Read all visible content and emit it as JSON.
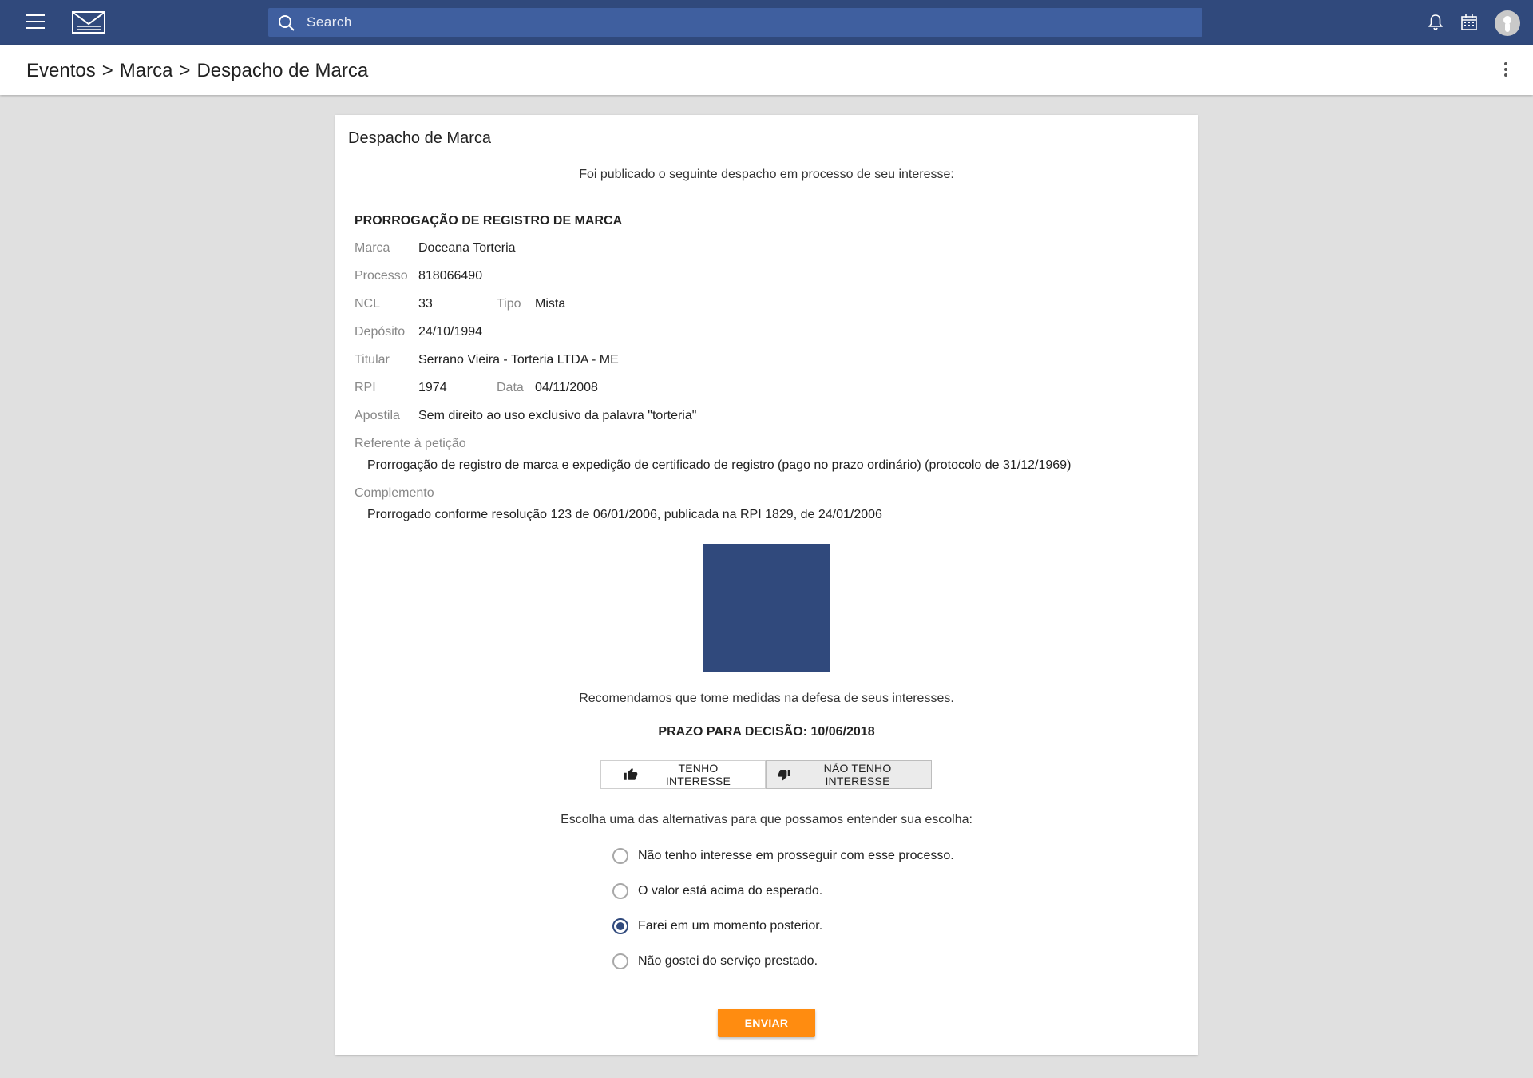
{
  "topbar": {
    "search_placeholder": "Search",
    "icons": [
      "menu-icon",
      "logo",
      "search-icon",
      "bell-icon",
      "calendar-icon",
      "avatar"
    ],
    "color": "#30497c"
  },
  "breadcrumb": {
    "items": [
      "Eventos",
      "Marca",
      "Despacho de Marca"
    ],
    "separator": ">"
  },
  "card": {
    "title": "Despacho de Marca",
    "intro": "Foi publicado o seguinte despacho em processo de seu interesse:",
    "heading": "PRORROGAÇÃO DE REGISTRO DE MARCA",
    "fields": {
      "marca_label": "Marca",
      "marca": "Doceana Torteria",
      "processo_label": "Processo",
      "processo": "818066490",
      "ncl_label": "NCL",
      "ncl": "33",
      "tipo_label": "Tipo",
      "tipo": "Mista",
      "deposito_label": "Depósito",
      "deposito": "24/10/1994",
      "titular_label": "Titular",
      "titular": "Serrano Vieira - Torteria LTDA - ME",
      "rpi_label": "RPI",
      "rpi": "1974",
      "data_label": "Data",
      "data": "04/11/2008",
      "apostila_label": "Apostila",
      "apostila": "Sem direito ao uso exclusivo da palavra \"torteria\""
    },
    "peticao_label": "Referente à petição",
    "peticao": "Prorrogação de registro de marca e expedição de certificado de registro (pago no prazo ordinário) (protocolo de 31/12/1969)",
    "complemento_label": "Complemento",
    "complemento": "Prorrogado conforme resolução 123 de 06/01/2006, publicada na RPI 1829, de 24/01/2006",
    "recommend": "Recomendamos que tome medidas na defesa de seus interesses.",
    "deadline": "PRAZO PARA DECISÃO: 10/06/2018",
    "buttons": {
      "interest": "TENHO INTERESSE",
      "no_interest": "NÃO TENHO INTERESSE",
      "selected": "no_interest"
    },
    "choose_text": "Escolha uma das alternativas para que possamos entender sua escolha:",
    "options": [
      {
        "label": "Não tenho interesse em prosseguir com esse processo.",
        "checked": false
      },
      {
        "label": "O valor está acima do esperado.",
        "checked": false
      },
      {
        "label": "Farei em um momento posterior.",
        "checked": true
      },
      {
        "label": "Não gostei do serviço prestado.",
        "checked": false
      }
    ],
    "submit": "ENVIAR",
    "submit_color": "#ff8c10"
  }
}
